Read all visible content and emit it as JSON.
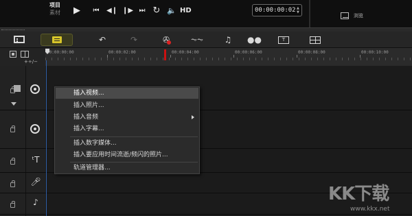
{
  "player": {
    "mode_project": "项目",
    "mode_clip": "素材",
    "play_icon": "play-icon",
    "hd_label": "HD",
    "timecode": "00:00:00:02",
    "browse_label": "浏览"
  },
  "toolbar": {
    "items": [
      "storyboard-view",
      "timeline-view",
      "undo",
      "redo",
      "record-capture",
      "audio-mixer",
      "auto-music",
      "motion-tracking",
      "subtitle-editor",
      "multi-camera"
    ]
  },
  "ruler": {
    "ticks": [
      "00:00:00:00",
      "00:00:02:00",
      "00:00:04:00",
      "00:00:06:00",
      "00:00:08:00",
      "00:00:10:00"
    ],
    "add_label": "+÷/−"
  },
  "context_menu": {
    "items": [
      {
        "label": "插入视频..."
      },
      {
        "label": "插入照片..."
      },
      {
        "label": "插入音频"
      },
      {
        "label": "插入字幕..."
      },
      {
        "label": "插入数字媒体..."
      },
      {
        "label": "插入要应用时间流逝/频闪的照片..."
      },
      {
        "label": "轨道管理器..."
      }
    ]
  },
  "watermark": {
    "text": "KK下载",
    "url": "www.kkx.net"
  },
  "colors": {
    "background": "#1d1d1d",
    "accent_timeline": "#d8c62a",
    "playhead": "#2f5fa8",
    "record": "#dd2222"
  }
}
